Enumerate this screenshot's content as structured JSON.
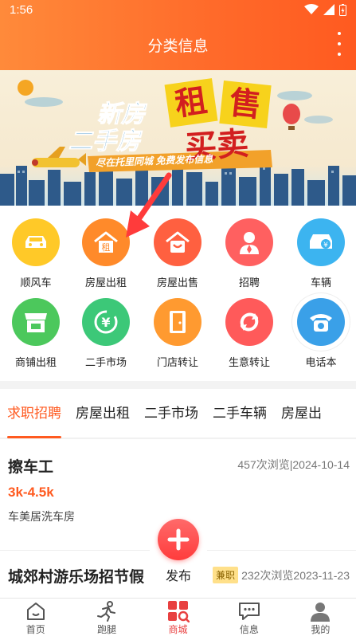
{
  "status": {
    "time": "1:56"
  },
  "header": {
    "title": "分类信息"
  },
  "banner": {
    "line1": "新房",
    "line2": "二手房",
    "big1": "租",
    "big2": "售",
    "big3": "买卖",
    "slogan": "尽在托里同城 免费发布信息"
  },
  "grid": [
    {
      "label": "顺风车",
      "color": "#ffc928",
      "icon": "car-icon"
    },
    {
      "label": "房屋出租",
      "color": "#ff8a2a",
      "icon": "house-rent-icon"
    },
    {
      "label": "房屋出售",
      "color": "#ff6040",
      "icon": "house-sale-icon"
    },
    {
      "label": "招聘",
      "color": "#ff6060",
      "icon": "recruit-icon"
    },
    {
      "label": "车辆",
      "color": "#3cb4f0",
      "icon": "vehicle-icon"
    },
    {
      "label": "商铺出租",
      "color": "#4cc85c",
      "icon": "shop-icon"
    },
    {
      "label": "二手市场",
      "color": "#3cc878",
      "icon": "recycle-icon"
    },
    {
      "label": "门店转让",
      "color": "#ff9a30",
      "icon": "door-icon"
    },
    {
      "label": "生意转让",
      "color": "#ff5a5a",
      "icon": "transfer-icon"
    },
    {
      "label": "电话本",
      "color": "#3aa0e8",
      "icon": "phone-icon"
    }
  ],
  "tabs": [
    "求职招聘",
    "房屋出租",
    "二手市场",
    "二手车辆",
    "房屋出"
  ],
  "listings": [
    {
      "title": "擦车工",
      "meta": "457次浏览|2024-10-14",
      "salary": "3k-4.5k",
      "company": "车美居洗车房"
    },
    {
      "title": "城郊村游乐场招节假",
      "badge": "兼职",
      "meta": "232次浏览2023-11-23"
    }
  ],
  "fab": {
    "label": "发布"
  },
  "nav": [
    {
      "label": "首页",
      "icon": "home-icon"
    },
    {
      "label": "跑腿",
      "icon": "runner-icon"
    },
    {
      "label": "商城",
      "icon": "mall-icon"
    },
    {
      "label": "信息",
      "icon": "message-icon"
    },
    {
      "label": "我的",
      "icon": "profile-icon"
    }
  ]
}
